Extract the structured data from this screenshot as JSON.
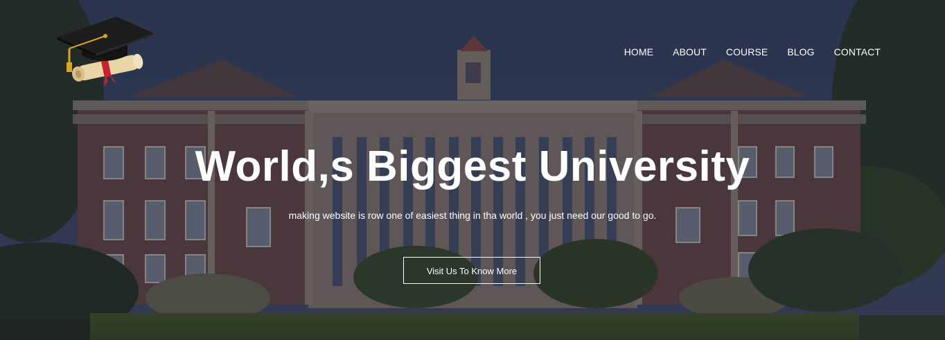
{
  "logo": {
    "icon": "graduation-cap-diploma-icon"
  },
  "nav": {
    "items": [
      {
        "label": "HOME"
      },
      {
        "label": "ABOUT"
      },
      {
        "label": "COURSE"
      },
      {
        "label": "BLOG"
      },
      {
        "label": "CONTACT"
      }
    ]
  },
  "hero": {
    "title": "World,s Biggest University",
    "subtitle": "making website is row one of easiest thing in tha world , you just need our good to go.",
    "cta_label": "Visit Us To Know More"
  },
  "colors": {
    "text": "#ffffff",
    "overlay": "#1a2238"
  }
}
